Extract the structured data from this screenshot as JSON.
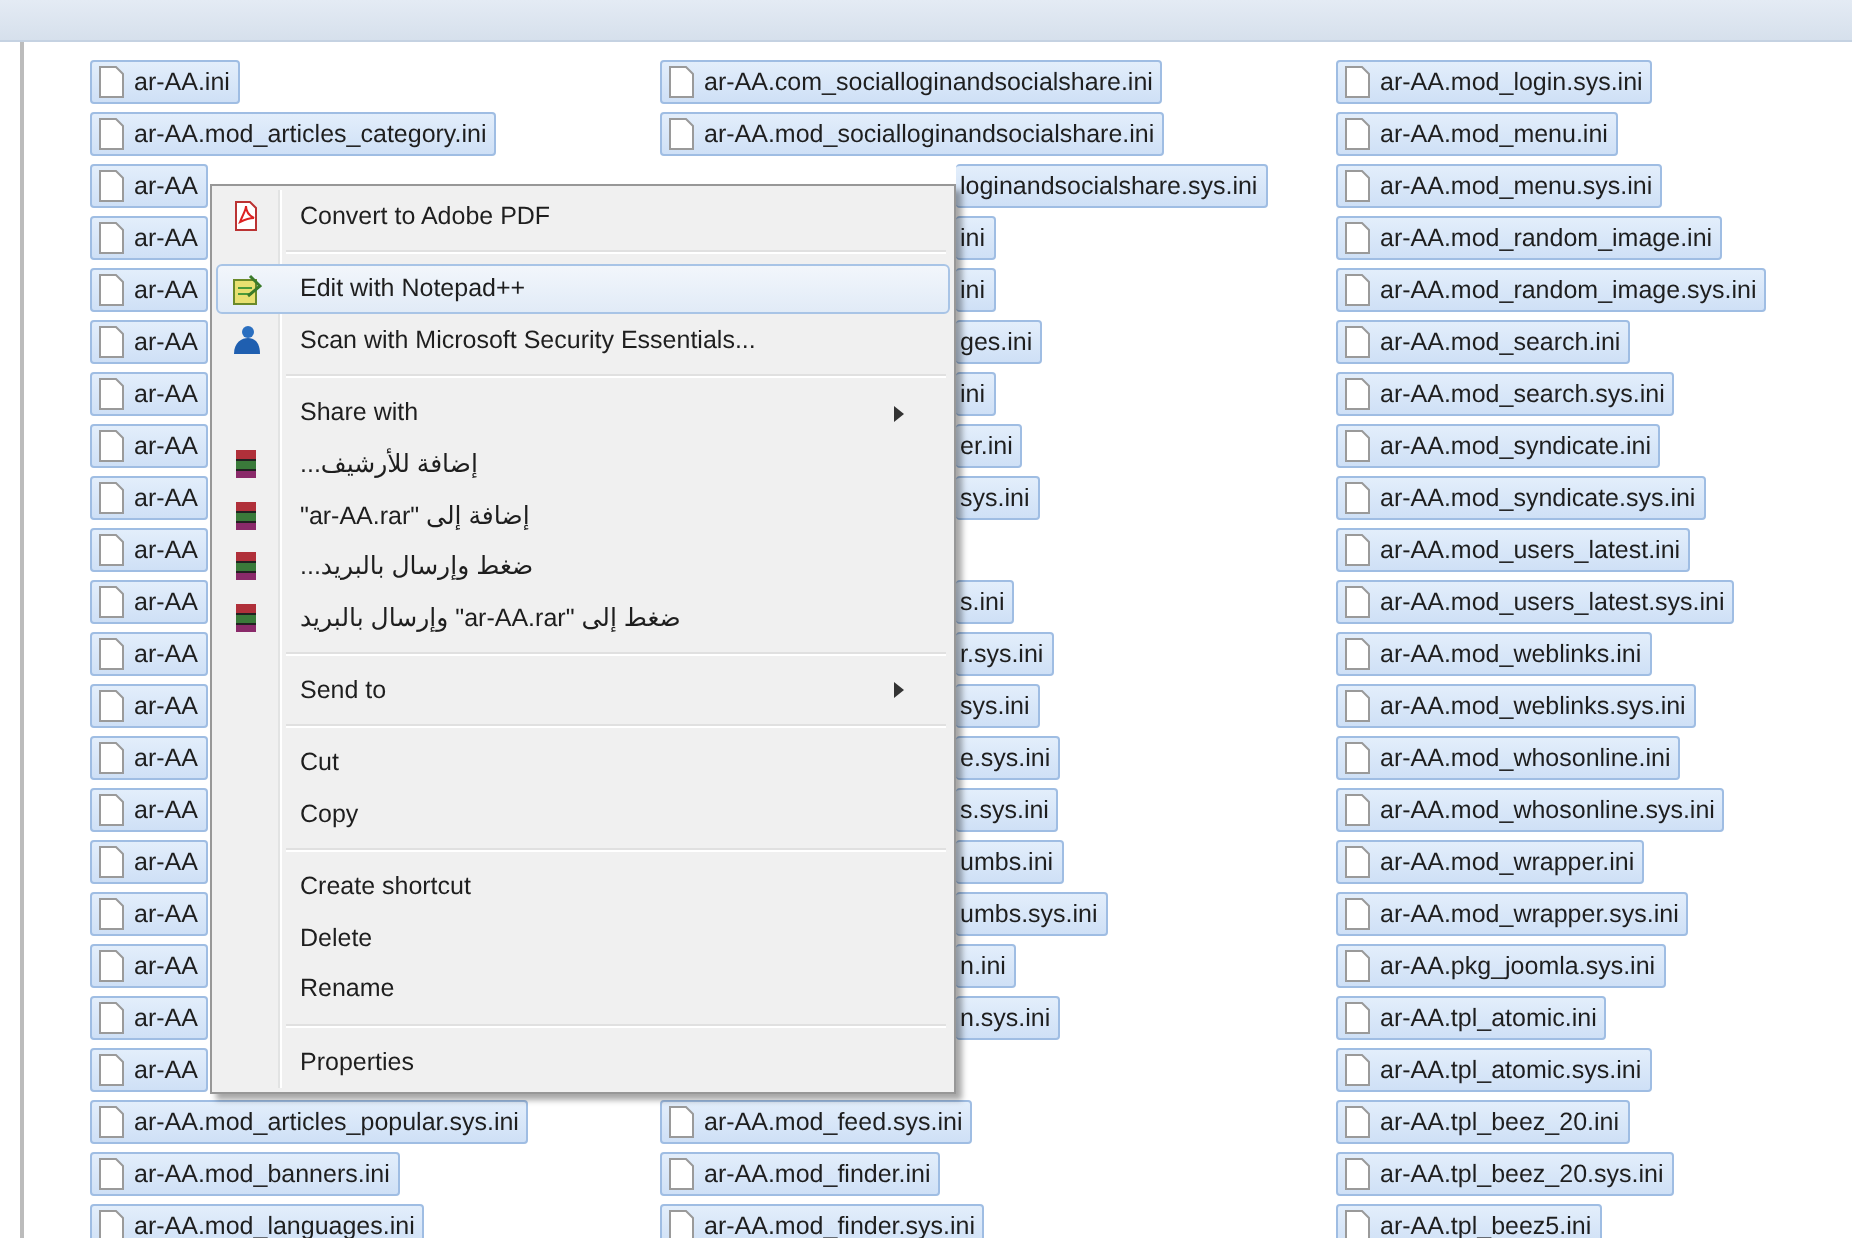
{
  "file_columns": [
    {
      "files": [
        {
          "kind": "file",
          "name": "ar-AA.ini",
          "selected": true
        },
        {
          "kind": "file",
          "name": "ar-AA.mod_articles_category.ini",
          "selected": true
        },
        {
          "kind": "file",
          "name": "ar-AA",
          "selected": true
        },
        {
          "kind": "file",
          "name": "ar-AA",
          "selected": true
        },
        {
          "kind": "file",
          "name": "ar-AA",
          "selected": true
        },
        {
          "kind": "file",
          "name": "ar-AA",
          "selected": true
        },
        {
          "kind": "file",
          "name": "ar-AA",
          "selected": true
        },
        {
          "kind": "file",
          "name": "ar-AA",
          "selected": true
        },
        {
          "kind": "file",
          "name": "ar-AA",
          "selected": true
        },
        {
          "kind": "file",
          "name": "ar-AA",
          "selected": true
        },
        {
          "kind": "file",
          "name": "ar-AA",
          "selected": true
        },
        {
          "kind": "file",
          "name": "ar-AA",
          "selected": true
        },
        {
          "kind": "file",
          "name": "ar-AA",
          "selected": true
        },
        {
          "kind": "file",
          "name": "ar-AA",
          "selected": true
        },
        {
          "kind": "file",
          "name": "ar-AA",
          "selected": true
        },
        {
          "kind": "file",
          "name": "ar-AA",
          "selected": true
        },
        {
          "kind": "file",
          "name": "ar-AA",
          "selected": true
        },
        {
          "kind": "file",
          "name": "ar-AA",
          "selected": true
        },
        {
          "kind": "file",
          "name": "ar-AA",
          "selected": true
        },
        {
          "kind": "file",
          "name": "ar-AA",
          "selected": true
        },
        {
          "kind": "file",
          "name": "ar-AA.mod_articles_popular.sys.ini",
          "selected": true
        },
        {
          "kind": "file",
          "name": "ar-AA.mod_banners.ini",
          "selected": true
        },
        {
          "kind": "file",
          "name": "ar-AA.mod_languages.ini",
          "selected": true
        }
      ]
    },
    {
      "files": [
        {
          "kind": "file",
          "name": "ar-AA.com_socialloginandsocialshare.ini",
          "selected": true
        },
        {
          "kind": "file",
          "name": "ar-AA.mod_socialloginandsocialshare.ini",
          "selected": true
        },
        {
          "kind": "clipped",
          "name": "loginandsocialshare.sys.ini",
          "selected": true
        },
        {
          "kind": "clipped",
          "name": "ini",
          "selected": true
        },
        {
          "kind": "clipped",
          "name": "ini",
          "selected": true
        },
        {
          "kind": "clipped",
          "name": "ges.ini",
          "selected": true
        },
        {
          "kind": "clipped",
          "name": "ini",
          "selected": true
        },
        {
          "kind": "clipped",
          "name": "er.ini",
          "selected": true
        },
        {
          "kind": "clipped",
          "name": "sys.ini",
          "selected": true
        },
        {
          "kind": "hidden"
        },
        {
          "kind": "clipped",
          "name": "s.ini",
          "selected": true
        },
        {
          "kind": "clipped",
          "name": "r.sys.ini",
          "selected": true
        },
        {
          "kind": "clipped",
          "name": "sys.ini",
          "selected": true
        },
        {
          "kind": "clipped",
          "name": "e.sys.ini",
          "selected": true
        },
        {
          "kind": "clipped",
          "name": "s.sys.ini",
          "selected": true
        },
        {
          "kind": "clipped",
          "name": "umbs.ini",
          "selected": true
        },
        {
          "kind": "clipped",
          "name": "umbs.sys.ini",
          "selected": true
        },
        {
          "kind": "clipped",
          "name": "n.ini",
          "selected": true
        },
        {
          "kind": "clipped",
          "name": "n.sys.ini",
          "selected": true
        },
        {
          "kind": "hidden"
        },
        {
          "kind": "file",
          "name": "ar-AA.mod_feed.sys.ini",
          "selected": true
        },
        {
          "kind": "file",
          "name": "ar-AA.mod_finder.ini",
          "selected": true
        },
        {
          "kind": "file",
          "name": "ar-AA.mod_finder.sys.ini",
          "selected": true
        }
      ]
    },
    {
      "files": [
        {
          "kind": "file",
          "name": "ar-AA.mod_login.sys.ini",
          "selected": true
        },
        {
          "kind": "file",
          "name": "ar-AA.mod_menu.ini",
          "selected": true
        },
        {
          "kind": "file",
          "name": "ar-AA.mod_menu.sys.ini",
          "selected": true
        },
        {
          "kind": "file",
          "name": "ar-AA.mod_random_image.ini",
          "selected": true
        },
        {
          "kind": "file",
          "name": "ar-AA.mod_random_image.sys.ini",
          "selected": true
        },
        {
          "kind": "file",
          "name": "ar-AA.mod_search.ini",
          "selected": true
        },
        {
          "kind": "file",
          "name": "ar-AA.mod_search.sys.ini",
          "selected": true
        },
        {
          "kind": "file",
          "name": "ar-AA.mod_syndicate.ini",
          "selected": true
        },
        {
          "kind": "file",
          "name": "ar-AA.mod_syndicate.sys.ini",
          "selected": true
        },
        {
          "kind": "file",
          "name": "ar-AA.mod_users_latest.ini",
          "selected": true
        },
        {
          "kind": "file",
          "name": "ar-AA.mod_users_latest.sys.ini",
          "selected": true
        },
        {
          "kind": "file",
          "name": "ar-AA.mod_weblinks.ini",
          "selected": true
        },
        {
          "kind": "file",
          "name": "ar-AA.mod_weblinks.sys.ini",
          "selected": true
        },
        {
          "kind": "file",
          "name": "ar-AA.mod_whosonline.ini",
          "selected": true
        },
        {
          "kind": "file",
          "name": "ar-AA.mod_whosonline.sys.ini",
          "selected": true
        },
        {
          "kind": "file",
          "name": "ar-AA.mod_wrapper.ini",
          "selected": true
        },
        {
          "kind": "file",
          "name": "ar-AA.mod_wrapper.sys.ini",
          "selected": true
        },
        {
          "kind": "file",
          "name": "ar-AA.pkg_joomla.sys.ini",
          "selected": true
        },
        {
          "kind": "file",
          "name": "ar-AA.tpl_atomic.ini",
          "selected": true
        },
        {
          "kind": "file",
          "name": "ar-AA.tpl_atomic.sys.ini",
          "selected": true
        },
        {
          "kind": "file",
          "name": "ar-AA.tpl_beez_20.ini",
          "selected": true
        },
        {
          "kind": "file",
          "name": "ar-AA.tpl_beez_20.sys.ini",
          "selected": true
        },
        {
          "kind": "file",
          "name": "ar-AA.tpl_beez5.ini",
          "selected": true
        }
      ]
    }
  ],
  "context_menu": {
    "items": [
      {
        "kind": "item",
        "label": "Convert to Adobe PDF",
        "selected": false,
        "submenu": false
      },
      {
        "kind": "separator"
      },
      {
        "kind": "item",
        "label": "Edit with Notepad++",
        "selected": true,
        "submenu": false
      },
      {
        "kind": "item",
        "label": "Scan with Microsoft Security Essentials...",
        "selected": false,
        "submenu": false
      },
      {
        "kind": "separator"
      },
      {
        "kind": "item",
        "label": "Share with",
        "selected": false,
        "submenu": true
      },
      {
        "kind": "item",
        "label": "إضافة للأرشيف...",
        "selected": false,
        "submenu": false
      },
      {
        "kind": "item",
        "label": "إضافة إلى \"ar-AA.rar\"",
        "selected": false,
        "submenu": false
      },
      {
        "kind": "item",
        "label": "ضغط وإرسال بالبريد...",
        "selected": false,
        "submenu": false
      },
      {
        "kind": "item",
        "label": "ضغط إلى \"ar-AA.rar\" وإرسال بالبريد",
        "selected": false,
        "submenu": false
      },
      {
        "kind": "separator"
      },
      {
        "kind": "item",
        "label": "Send to",
        "selected": false,
        "submenu": true
      },
      {
        "kind": "separator"
      },
      {
        "kind": "item",
        "label": "Cut",
        "selected": false,
        "submenu": false
      },
      {
        "kind": "item",
        "label": "Copy",
        "selected": false,
        "submenu": false
      },
      {
        "kind": "separator"
      },
      {
        "kind": "item",
        "label": "Create shortcut",
        "selected": false,
        "submenu": false
      },
      {
        "kind": "item",
        "label": "Delete",
        "selected": false,
        "submenu": false
      },
      {
        "kind": "item",
        "label": "Rename",
        "selected": false,
        "submenu": false
      },
      {
        "kind": "separator"
      },
      {
        "kind": "item",
        "label": "Properties",
        "selected": false,
        "submenu": false
      }
    ]
  }
}
